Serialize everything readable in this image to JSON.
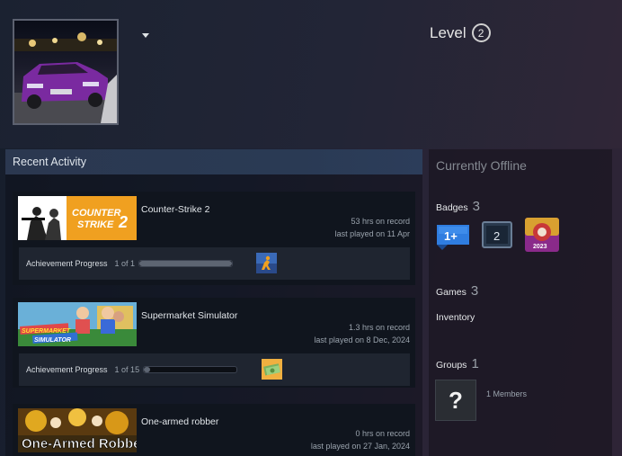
{
  "profile": {
    "level_label": "Level",
    "level_value": "2"
  },
  "recent_activity": {
    "title": "Recent Activity",
    "games": [
      {
        "name": "Counter-Strike 2",
        "hours": "53 hrs on record",
        "last_played": "last played on 11 Apr",
        "capsule_text_line1": "COUNTER",
        "capsule_text_line2": "STRIKE",
        "capsule_text_num": "2",
        "achievement_label": "Achievement Progress",
        "achievement_count": "1 of 1",
        "achievement_fraction": 1.0
      },
      {
        "name": "Supermarket Simulator",
        "hours": "1.3 hrs on record",
        "last_played": "last played on 8 Dec, 2024",
        "capsule_text_line1": "SUPERMARKET",
        "capsule_text_line2": "SIMULATOR",
        "achievement_label": "Achievement Progress",
        "achievement_count": "1 of 15",
        "achievement_fraction": 0.0667
      },
      {
        "name": "One-armed robber",
        "hours": "0 hrs on record",
        "last_played": "last played on 27 Jan, 2024",
        "capsule_text": "One-Armed Robber"
      }
    ]
  },
  "sidebar": {
    "status": "Currently Offline",
    "badges_label": "Badges",
    "badges_count": "3",
    "badges": [
      {
        "icon": "one-plus-badge-icon",
        "text": "1+",
        "color": "#3a7bd5"
      },
      {
        "icon": "level-2-badge-icon",
        "text": "2",
        "color": "#3b4a5c"
      },
      {
        "icon": "steam-2023-badge-icon",
        "text": "2023",
        "color": "#b3262f"
      }
    ],
    "games_label": "Games",
    "games_count": "3",
    "inventory_label": "Inventory",
    "groups_label": "Groups",
    "groups_count": "1",
    "group_avatar_text": "?",
    "group_members": "1 Members"
  }
}
